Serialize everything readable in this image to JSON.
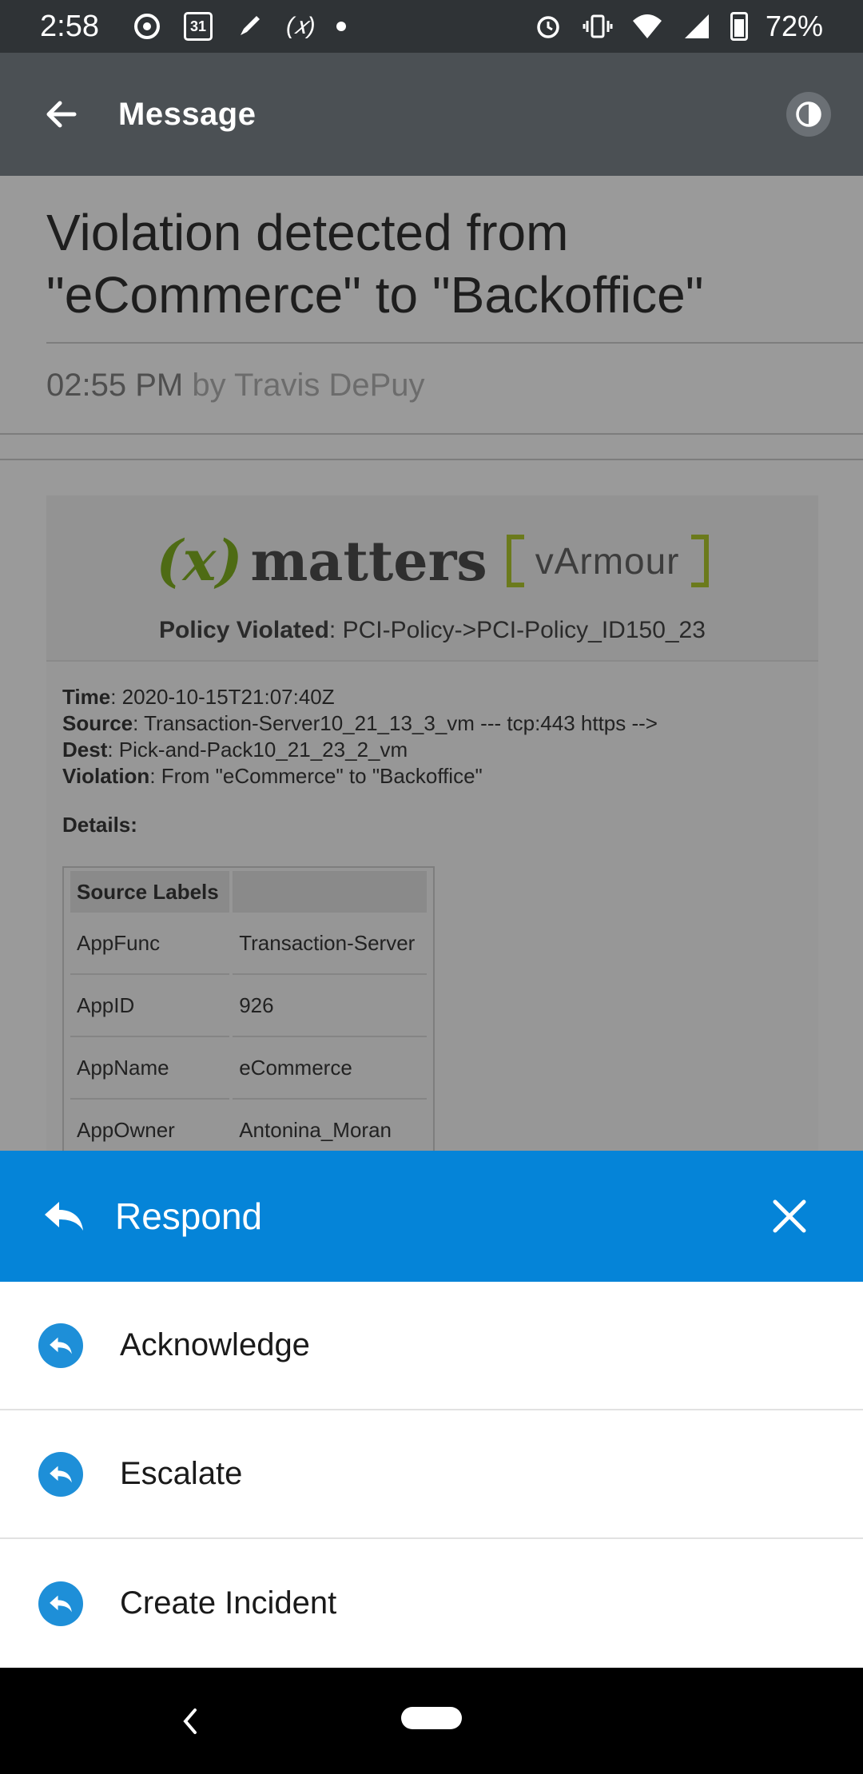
{
  "status_bar": {
    "time": "2:58",
    "calendar_day": "31",
    "battery_percent": "72%"
  },
  "app_bar": {
    "title": "Message"
  },
  "message": {
    "title": "Violation detected from \"eCommerce\" to \"Backoffice\"",
    "time": "02:55 PM",
    "by": "by Travis DePuy",
    "logo_xmatters": "matters",
    "logo_xmatters_prefix": "(x)",
    "logo_varmour": "vArmour",
    "policy_label": "Policy Violated",
    "policy_value": ": PCI-Policy->PCI-Policy_ID150_23",
    "fields": [
      {
        "label": "Time",
        "value": ": 2020-10-15T21:07:40Z"
      },
      {
        "label": "Source",
        "value": ": Transaction-Server10_21_13_3_vm --- tcp:443 https -->"
      },
      {
        "label": "Dest",
        "value": ": Pick-and-Pack10_21_23_2_vm"
      },
      {
        "label": "Violation",
        "value": ": From \"eCommerce\" to \"Backoffice\""
      }
    ],
    "details_label": "Details:",
    "table": {
      "header": [
        "Source Labels",
        ""
      ],
      "rows": [
        [
          "AppFunc",
          "Transaction-Server"
        ],
        [
          "AppID",
          "926"
        ],
        [
          "AppName",
          "eCommerce"
        ],
        [
          "AppOwner",
          "Antonina_Moran"
        ]
      ]
    }
  },
  "respond": {
    "title": "Respond",
    "options": [
      {
        "label": "Acknowledge"
      },
      {
        "label": "Escalate"
      },
      {
        "label": "Create Incident"
      }
    ]
  },
  "colors": {
    "accent": "#0584d8",
    "app_bar": "#4b5054",
    "status_bar": "#2f3336"
  }
}
